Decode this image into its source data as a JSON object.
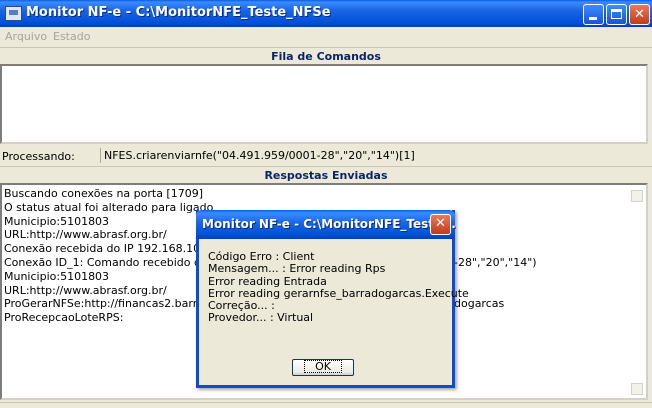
{
  "window": {
    "title": "Monitor NF-e - C:\\MonitorNFE_Teste_NFSe",
    "minimize_glyph": "",
    "maximize_glyph": "",
    "close_glyph": "✕"
  },
  "menu": {
    "items": [
      {
        "label": "Arquivo"
      },
      {
        "label": "Estado"
      }
    ]
  },
  "queue": {
    "header": "Fila de Comandos"
  },
  "processing": {
    "label": "Processando:",
    "value": "NFES.criarenviarnfe(\"04.491.959/0001-28\",\"20\",\"14\")[1]"
  },
  "responses": {
    "header": "Respostas Enviadas",
    "lines": [
      "Buscando conexões na porta [1709]",
      "O status atual foi alterado para ligado",
      "Municipio:5101803",
      "URL:http://www.abrasf.org.br/",
      "Conexão recebida do IP 192.168.10.67:1",
      "Conexão ID_1: Comando recebido de 19",
      "Municipio:5101803",
      "URL:http://www.abrasf.org.br/",
      "ProGerarNFSe:http://financas2.barradog",
      "ProRecepcaoLoteRPS:"
    ],
    "overflow_right": [
      {
        "row": 5,
        "text": "-28\",\"20\",\"14\")"
      },
      {
        "row": 8,
        "text": "dogarcas"
      }
    ]
  },
  "dialog": {
    "title": "Monitor NF-e - C:\\MonitorNFE_Teste...",
    "close_glyph": "✕",
    "lines": [
      "Código Erro : Client",
      "Mensagem... : Error reading Rps",
      "Error reading Entrada",
      "Error reading gerarnfse_barradogarcas.Execute",
      "Correção... :",
      "Provedor... : Virtual"
    ],
    "ok_label": "OK"
  },
  "colors": {
    "titlebar": "#0050d8",
    "header_text": "#0a246a",
    "background": "#ece9d8"
  }
}
